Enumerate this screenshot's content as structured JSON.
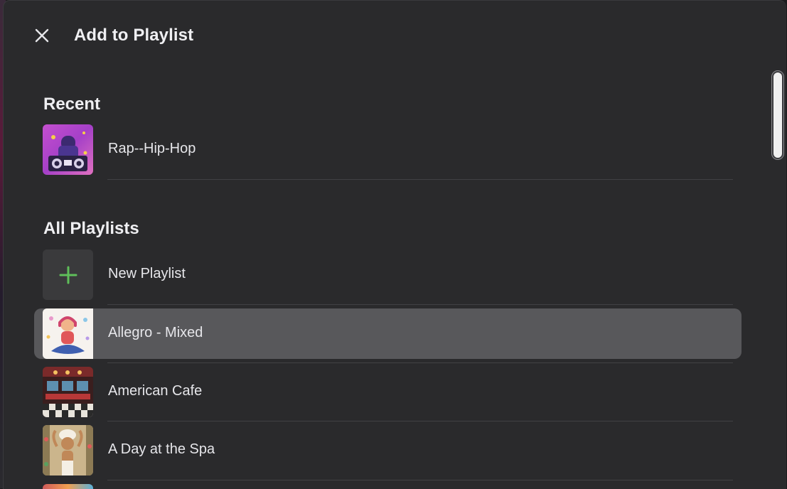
{
  "dialog": {
    "title": "Add to Playlist",
    "close_icon": "close-icon"
  },
  "recent": {
    "header": "Recent",
    "items": [
      {
        "label": "Rap--Hip-Hop",
        "art": "hiphop-artwork"
      }
    ]
  },
  "all_playlists": {
    "header": "All Playlists",
    "new_playlist": {
      "label": "New Playlist",
      "icon": "plus-icon",
      "icon_color": "#5fbf5a"
    },
    "items": [
      {
        "label": "Allegro - Mixed",
        "art": "meditation-artwork",
        "selected": true
      },
      {
        "label": "American Cafe",
        "art": "diner-artwork",
        "selected": false
      },
      {
        "label": "A Day at the Spa",
        "art": "spa-artwork",
        "selected": false
      }
    ]
  },
  "colors": {
    "background": "#2a2a2c",
    "selected_row": "#58585b",
    "accent_green": "#5fbf5a"
  }
}
